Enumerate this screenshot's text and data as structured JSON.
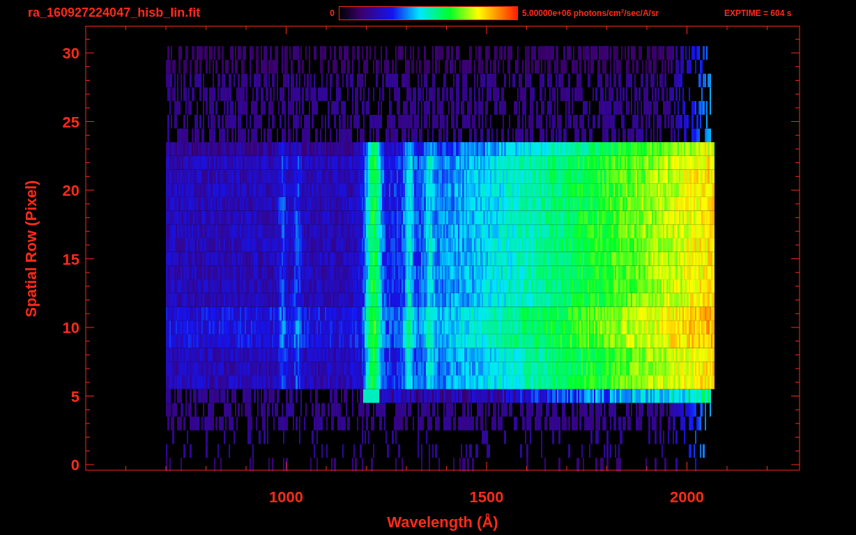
{
  "title": "ra_160927224047_hisb_lin.fit",
  "colorbar": {
    "min_label": "0",
    "max_label": "5.00000e+06 photons/cm$^{2}$/sec/A/sr"
  },
  "exposure": "EXPTIME = 604 s",
  "plot": {
    "xlabel": "Wavelength (Å)",
    "ylabel": "Spatial Row (Pixel)",
    "xticks": [
      "1000",
      "1500",
      "2000"
    ],
    "yticks": [
      "30",
      "25",
      "20",
      "15",
      "10",
      "5",
      "0"
    ]
  }
}
